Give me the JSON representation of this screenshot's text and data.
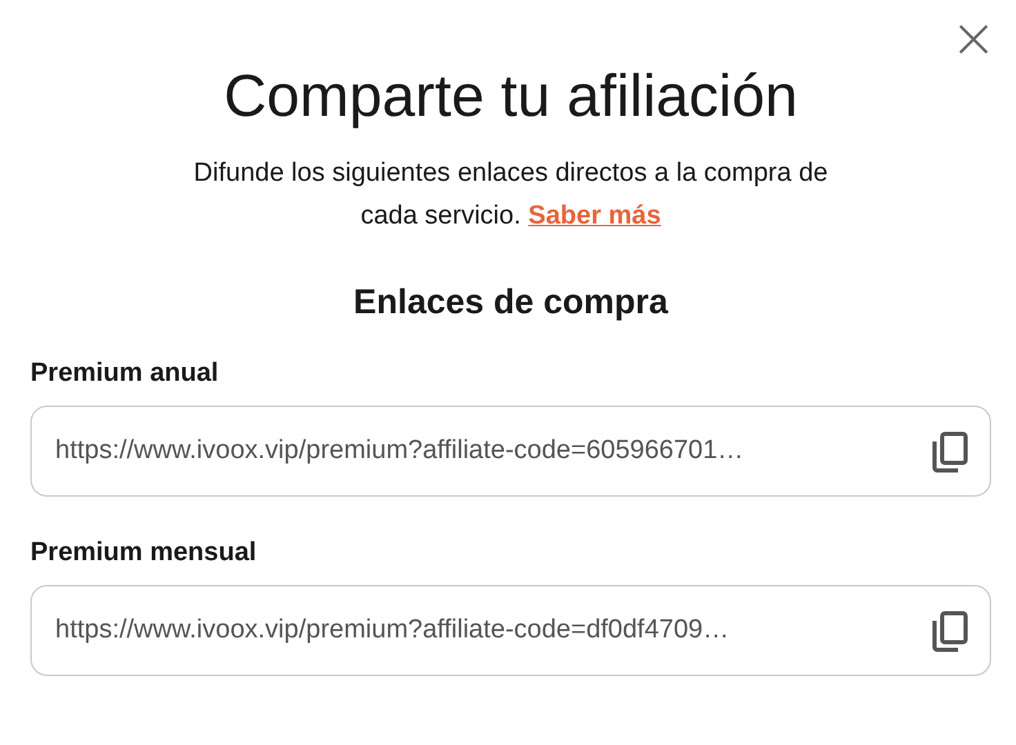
{
  "dialog": {
    "close_label": "×",
    "title": "Comparte tu afiliación",
    "description": "Difunde los siguientes enlaces directos a la compra de cada servicio.",
    "learn_more_link": "Saber más",
    "section_title": "Enlaces de compra",
    "links": [
      {
        "label": "Premium anual",
        "value": "https://www.ivoox.vip/premium?affiliate-code=605966701…"
      },
      {
        "label": "Premium mensual",
        "value": "https://www.ivoox.vip/premium?affiliate-code=df0df4709…"
      }
    ]
  }
}
